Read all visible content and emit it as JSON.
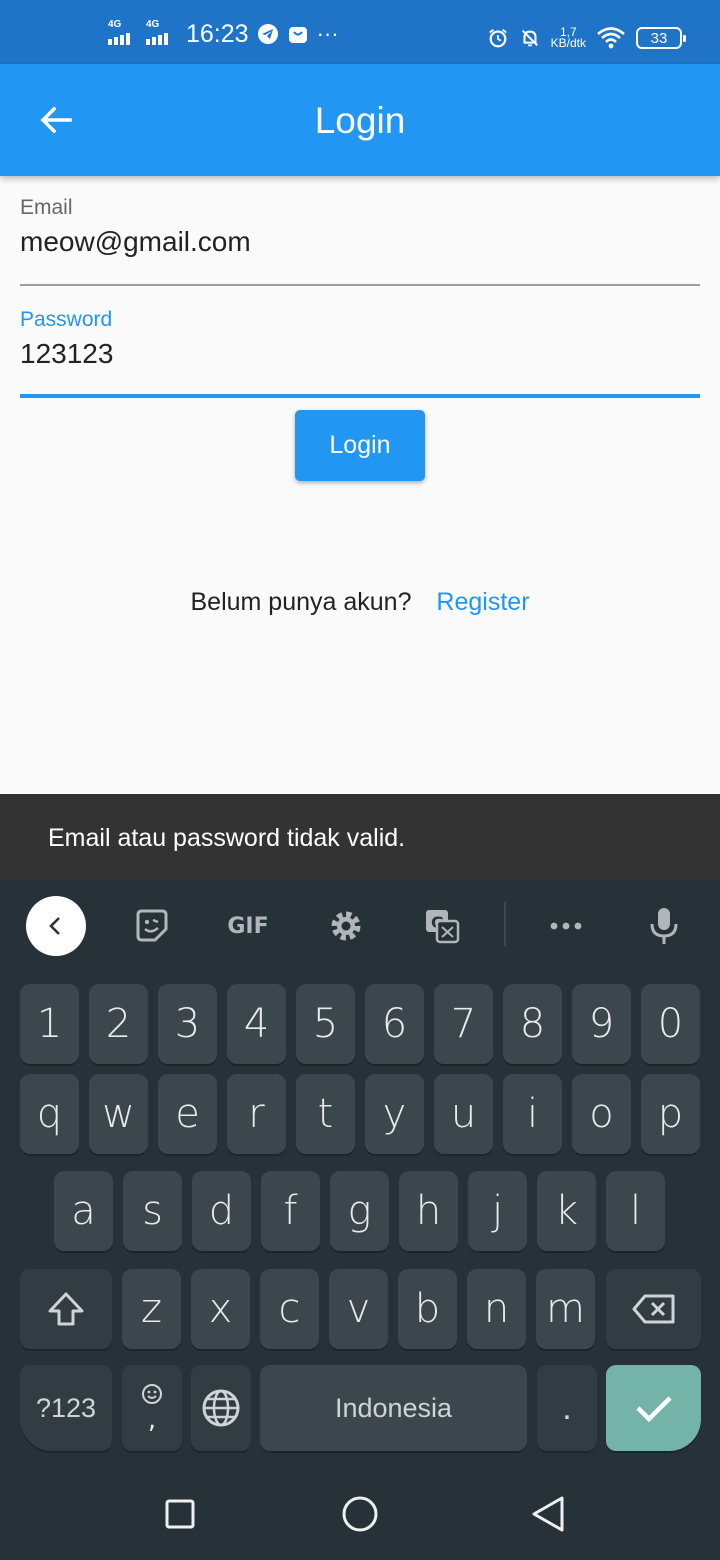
{
  "status_bar": {
    "network_1": "4G",
    "network_2": "4G",
    "time": "16:23",
    "speed_value": "1,7",
    "speed_unit": "KB/dtk",
    "battery": "33",
    "overflow": "···"
  },
  "app_bar": {
    "title": "Login",
    "back_icon": "arrow-left-icon",
    "background": "#2196f3"
  },
  "form": {
    "email": {
      "label": "Email",
      "value": "meow@gmail.com"
    },
    "password": {
      "label": "Password",
      "value": "123123"
    },
    "login_button": "Login",
    "register_prompt": "Belum punya akun?",
    "register_link": "Register",
    "accent_color": "#2196f3"
  },
  "snackbar": {
    "message": "Email atau password tidak valid."
  },
  "keyboard": {
    "toolbar": {
      "gif": "GIF",
      "icons": [
        "chevron-left-icon",
        "sticker-icon",
        "gif-icon",
        "settings-icon",
        "translate-icon",
        "more-icon",
        "mic-icon"
      ]
    },
    "number_row": [
      "1",
      "2",
      "3",
      "4",
      "5",
      "6",
      "7",
      "8",
      "9",
      "0"
    ],
    "row1": [
      "q",
      "w",
      "e",
      "r",
      "t",
      "y",
      "u",
      "i",
      "o",
      "p"
    ],
    "row2": [
      "a",
      "s",
      "d",
      "f",
      "g",
      "h",
      "j",
      "k",
      "l"
    ],
    "row3": [
      "z",
      "x",
      "c",
      "v",
      "b",
      "n",
      "m"
    ],
    "symbols_key": "?123",
    "comma_key": ",",
    "space_label": "Indonesia",
    "period_key": ".",
    "enter_color": "#74b3a7"
  },
  "nav_bar": {
    "icons": [
      "recent-apps-icon",
      "home-icon",
      "back-icon"
    ]
  }
}
